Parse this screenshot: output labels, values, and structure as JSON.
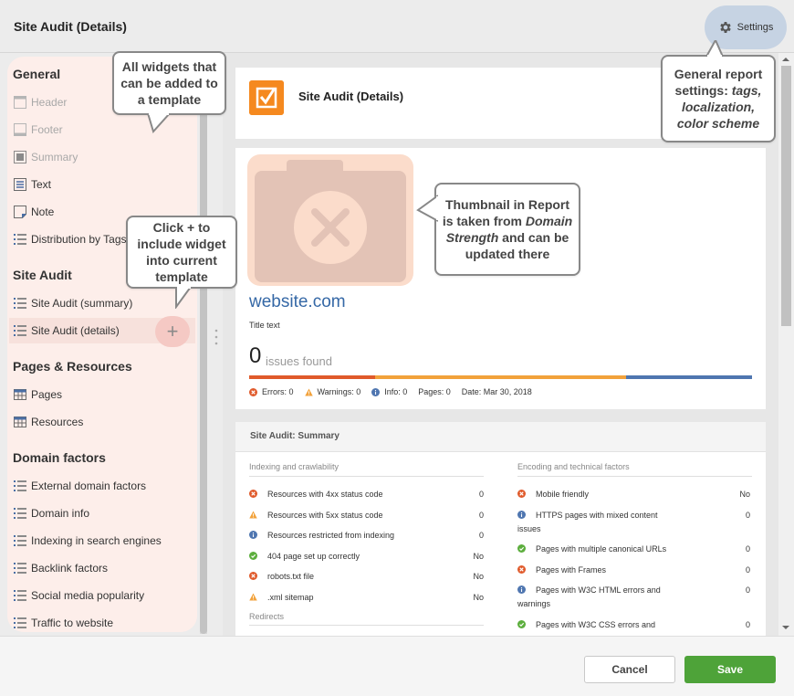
{
  "header": {
    "title": "Site Audit (Details)",
    "settings_label": "Settings"
  },
  "sidebar": {
    "sections": [
      {
        "title": "General",
        "items": [
          "Header",
          "Footer",
          "Summary",
          "Text",
          "Note",
          "Distribution by Tags"
        ]
      },
      {
        "title": "Site Audit",
        "items": [
          "Site Audit (summary)",
          "Site Audit (details)"
        ]
      },
      {
        "title": "Pages & Resources",
        "items": [
          "Pages",
          "Resources"
        ]
      },
      {
        "title": "Domain factors",
        "items": [
          "External domain factors",
          "Domain info",
          "Indexing in search engines",
          "Backlink factors",
          "Social media popularity",
          "Traffic to website"
        ]
      }
    ],
    "add_button": "+"
  },
  "report": {
    "title": "Site Audit (Details)",
    "domain": "website.com",
    "title_text": "Title text",
    "issues_count": "0",
    "issues_label": "issues found",
    "progress": {
      "errors": 0.25,
      "warnings": 0.5,
      "info": 0.25
    },
    "stats": {
      "errors": "Errors: 0",
      "warnings": "Warnings: 0",
      "info": "Info: 0",
      "pages": "Pages: 0",
      "date": "Date: Mar 30, 2018"
    }
  },
  "summary": {
    "title": "Site Audit: Summary",
    "left_heading": "Indexing and crawlability",
    "right_heading": "Encoding and technical factors",
    "left_rows": [
      {
        "icon": "error",
        "label": "Resources with 4xx status code",
        "value": "0"
      },
      {
        "icon": "warning",
        "label": "Resources with 5xx status code",
        "value": "0"
      },
      {
        "icon": "info",
        "label": "Resources restricted from indexing",
        "value": "0"
      },
      {
        "icon": "ok",
        "label": "404 page set up correctly",
        "value": "No"
      },
      {
        "icon": "error",
        "label": "robots.txt file",
        "value": "No"
      },
      {
        "icon": "warning",
        "label": ".xml sitemap",
        "value": "No"
      }
    ],
    "redirects_heading": "Redirects",
    "right_rows": [
      {
        "icon": "error",
        "label": "Mobile friendly",
        "label2": "",
        "value": "No"
      },
      {
        "icon": "info",
        "label": "HTTPS pages with mixed content",
        "label2": "issues",
        "value": "0"
      },
      {
        "icon": "ok",
        "label": "Pages with multiple canonical URLs",
        "label2": "",
        "value": "0"
      },
      {
        "icon": "error",
        "label": "Pages with Frames",
        "label2": "",
        "value": "0"
      },
      {
        "icon": "info",
        "label": "Pages with W3C HTML errors and",
        "label2": "warnings",
        "value": "0"
      },
      {
        "icon": "ok",
        "label": "Pages with W3C CSS errors and",
        "label2": "",
        "value": "0"
      }
    ]
  },
  "callouts": {
    "widgets": "All widgets that can be added to a template",
    "plus": "Click + to include widget into current template",
    "settings_pre": "General report settings: ",
    "settings_em": "tags, localization, color scheme",
    "thumb_pre": "Thumbnail in Report is taken from ",
    "thumb_em": "Domain Strength",
    "thumb_post": " and can be updated there"
  },
  "footer": {
    "cancel": "Cancel",
    "save": "Save"
  },
  "colors": {
    "accent": "#4ea339",
    "error": "#e05a2b",
    "warning": "#f2a23b",
    "info": "#4f76b0",
    "ok": "#5cae3d",
    "logo": "#f5891f"
  }
}
